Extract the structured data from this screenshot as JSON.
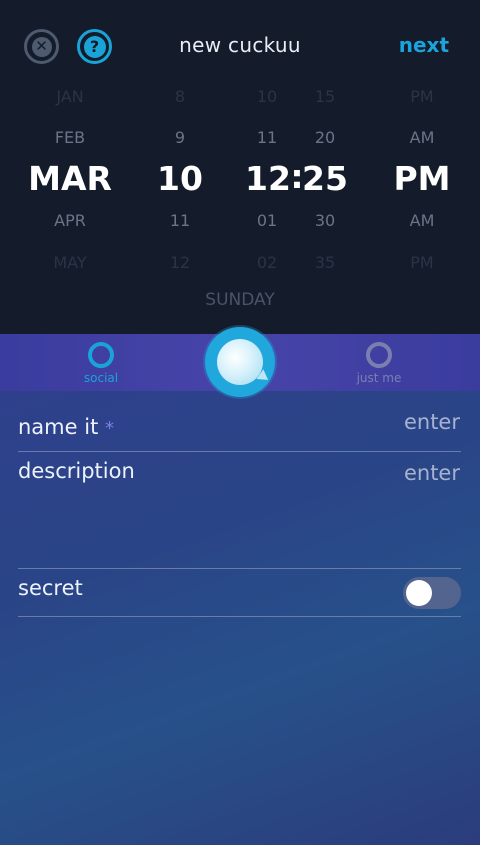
{
  "header": {
    "title": "new cuckuu",
    "next_label": "next",
    "close_icon": "close-icon",
    "help_icon": "help-icon"
  },
  "picker": {
    "month": [
      "JAN",
      "FEB",
      "MAR",
      "APR",
      "MAY"
    ],
    "day": [
      "8",
      "9",
      "10",
      "11",
      "12"
    ],
    "hour": [
      "10",
      "11",
      "12",
      "01",
      "02"
    ],
    "separator": ":",
    "minute": [
      "15",
      "20",
      "25",
      "30",
      "35"
    ],
    "ampm": [
      "PM",
      "AM",
      "PM",
      "AM",
      "PM"
    ],
    "selected_index": 2,
    "weekday": "SUNDAY"
  },
  "tabs": {
    "social": "social",
    "just_me": "just me",
    "active": "social"
  },
  "form": {
    "name_label": "name it",
    "required_mark": "*",
    "name_value": "enter",
    "description_label": "description",
    "description_value": "enter",
    "secret_label": "secret",
    "secret_on": false
  },
  "colors": {
    "accent": "#1aa3d6",
    "top_bg": "#141b2b",
    "tab_bg": "#4242a6"
  }
}
